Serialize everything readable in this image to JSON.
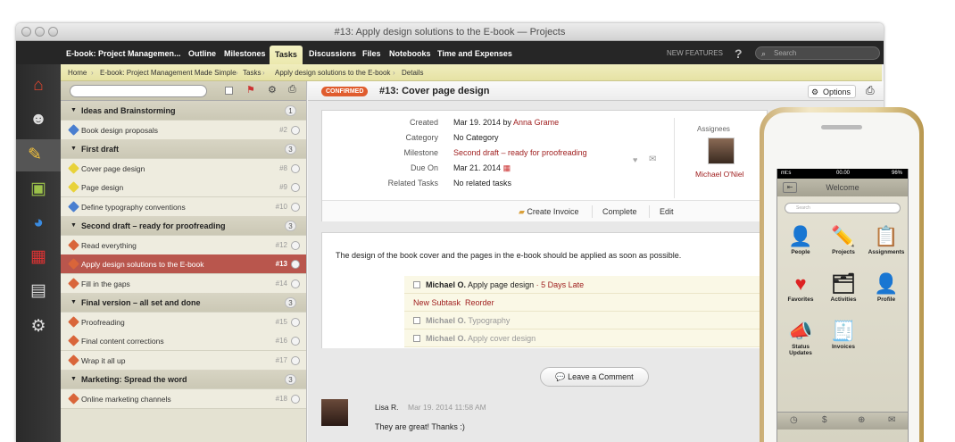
{
  "window": {
    "title": "#13: Apply design solutions to the E-book — Projects"
  },
  "nav": {
    "project": "E-book: Project Managemen...",
    "tabs": [
      "Outline",
      "Milestones",
      "Tasks",
      "Discussions",
      "Files",
      "Notebooks",
      "Time and Expenses"
    ],
    "new_features": "NEW FEATURES",
    "help": "?",
    "search_placeholder": "Search"
  },
  "breadcrumb": [
    "Home",
    "E-book: Project Management Made Simple",
    "Tasks",
    "Apply design solutions to the E-book",
    "Details"
  ],
  "sidebar": {
    "rows": [
      {
        "kind": "group",
        "label": "Ideas and Brainstorming",
        "count": "1"
      },
      {
        "kind": "item",
        "label": "Book design proposals",
        "num": "#2",
        "color": "#4a7fd0"
      },
      {
        "kind": "group",
        "label": "First draft",
        "count": "3"
      },
      {
        "kind": "item",
        "label": "Cover page design",
        "num": "#8",
        "color": "#e8d23a"
      },
      {
        "kind": "item",
        "label": "Page design",
        "num": "#9",
        "color": "#e8d23a"
      },
      {
        "kind": "item",
        "label": "Define typography conventions",
        "num": "#10",
        "color": "#4a7fd0"
      },
      {
        "kind": "group",
        "label": "Second draft – ready for proofreading",
        "count": "3"
      },
      {
        "kind": "item",
        "label": "Read everything",
        "num": "#12",
        "color": "#d9653a"
      },
      {
        "kind": "item",
        "label": "Apply design solutions to the E-book",
        "num": "#13",
        "color": "#d9653a",
        "selected": true
      },
      {
        "kind": "item",
        "label": "Fill in the gaps",
        "num": "#14",
        "color": "#d9653a"
      },
      {
        "kind": "group",
        "label": "Final version – all set and done",
        "count": "3"
      },
      {
        "kind": "item",
        "label": "Proofreading",
        "num": "#15",
        "color": "#d9653a"
      },
      {
        "kind": "item",
        "label": "Final content corrections",
        "num": "#16",
        "color": "#d9653a"
      },
      {
        "kind": "item",
        "label": "Wrap it all up",
        "num": "#17",
        "color": "#d9653a"
      },
      {
        "kind": "group",
        "label": "Marketing: Spread the word",
        "count": "3"
      },
      {
        "kind": "item",
        "label": "Online marketing channels",
        "num": "#18",
        "color": "#d9653a"
      }
    ]
  },
  "task": {
    "badge": "CONFIRMED",
    "title": "#13: Cover page design",
    "options": "Options",
    "fields": [
      {
        "label": "Created",
        "value": "Mar 19. 2014 by ",
        "link": "Anna Grame"
      },
      {
        "label": "Category",
        "value": "No Category"
      },
      {
        "label": "Milestone",
        "value": "Second draft – ready for proofreading"
      },
      {
        "label": "Due On",
        "value": "Mar 21. 2014"
      },
      {
        "label": "Related Tasks",
        "value": "No related tasks"
      }
    ],
    "assignees_label": "Assignees",
    "assignee": "Michael O'Niel",
    "actions": [
      "Create Invoice",
      "Complete",
      "Edit"
    ],
    "description": "The design of the book cover and the pages in the e-book should be applied as soon as possible.",
    "subtasks": [
      {
        "who": "Michael O.",
        "text": "Apply page design",
        "late": "· 5 Days Late",
        "done": false
      },
      {
        "who": "Michael O.",
        "text": "Typography",
        "done": true
      },
      {
        "who": "Michael O.",
        "text": "Apply cover design",
        "done": true
      }
    ],
    "new_subtask": "New Subtask",
    "reorder": "Reorder",
    "leave_comment": "Leave a Comment",
    "comment": {
      "author": "Lisa R.",
      "date": "Mar 19. 2014 11:58 AM",
      "text": "They are great! Thanks :)"
    }
  },
  "phone": {
    "carrier": "mt:s",
    "time": "00.00",
    "battery": "96%",
    "title": "Welcome",
    "search": "Search",
    "icons": [
      "People",
      "Projects",
      "Assignments",
      "Favorites",
      "Activities",
      "Profile",
      "Status Updates",
      "Invoices"
    ]
  }
}
